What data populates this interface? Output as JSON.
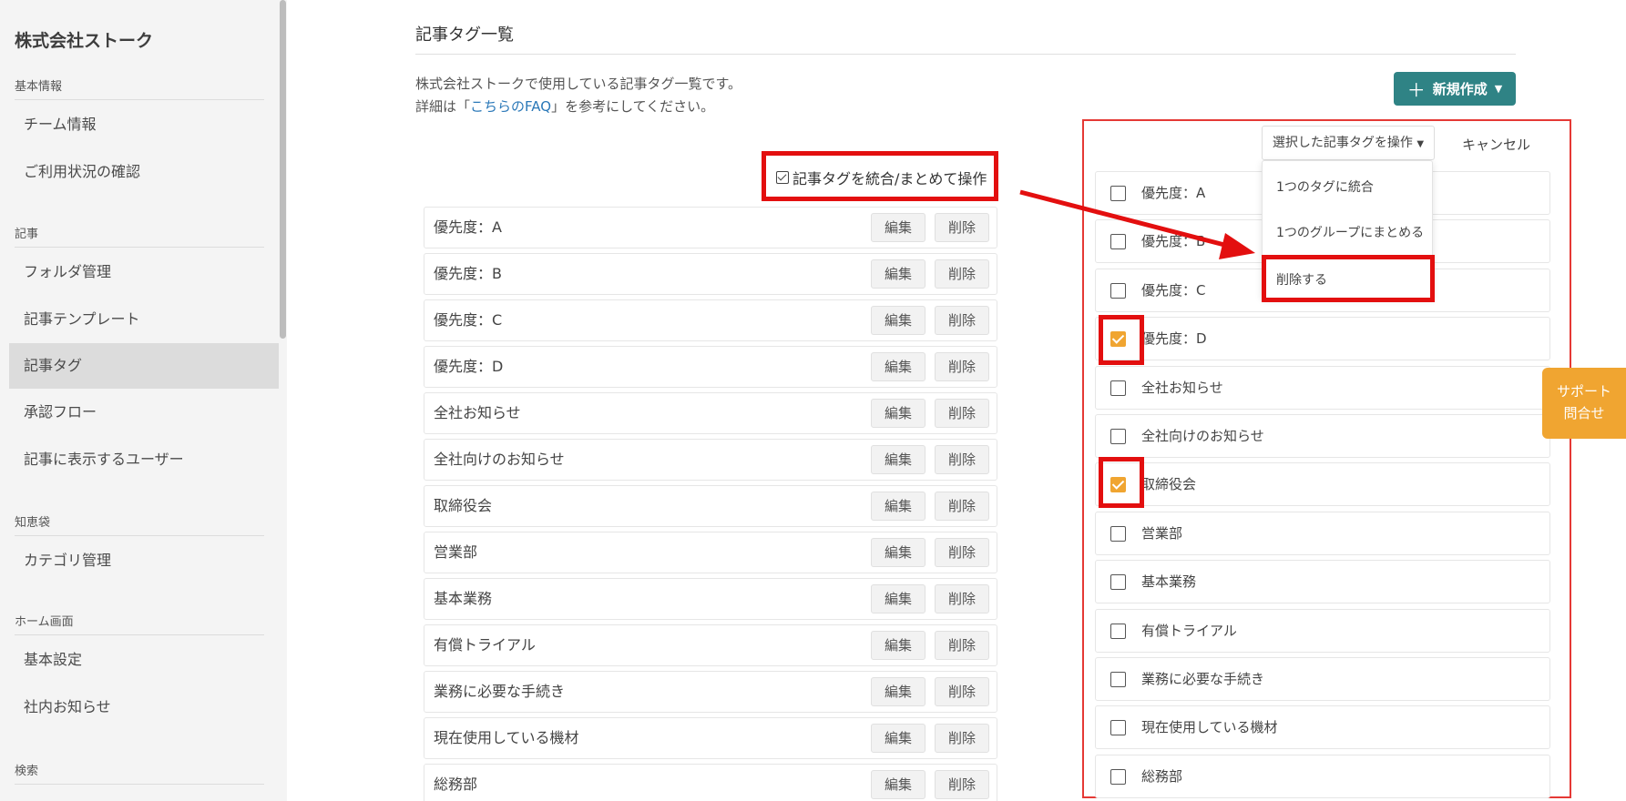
{
  "sidebar": {
    "brand": "株式会社ストーク",
    "sections": [
      {
        "heading": "基本情報",
        "items": [
          "チーム情報",
          "ご利用状況の確認"
        ]
      },
      {
        "heading": "記事",
        "items": [
          "フォルダ管理",
          "記事テンプレート",
          "記事タグ",
          "承認フロー",
          "記事に表示するユーザー"
        ]
      },
      {
        "heading": "知恵袋",
        "items": [
          "カテゴリ管理"
        ]
      },
      {
        "heading": "ホーム画面",
        "items": [
          "基本設定",
          "社内お知らせ"
        ]
      },
      {
        "heading": "検索",
        "items": []
      }
    ],
    "active_item": "記事タグ"
  },
  "main": {
    "title": "記事タグ一覧",
    "desc_line1": "株式会社ストークで使用している記事タグ一覧です。",
    "desc_line2_pre": "詳細は「",
    "desc_line2_link": "こちらのFAQ",
    "desc_line2_post": "」を参考にしてください。",
    "new_button": "新規作成",
    "merge_link": "記事タグを統合/まとめて操作",
    "edit_label": "編集",
    "delete_label": "削除",
    "tags": [
      "優先度：A",
      "優先度：B",
      "優先度：C",
      "優先度：D",
      "全社お知らせ",
      "全社向けのお知らせ",
      "取締役会",
      "営業部",
      "基本業務",
      "有償トライアル",
      "業務に必要な手続き",
      "現在使用している機材",
      "総務部"
    ]
  },
  "panel": {
    "operate_dropdown": "選択した記事タグを操作",
    "cancel": "キャンセル",
    "menu_items": [
      "1つのタグに統合",
      "1つのグループにまとめる",
      "削除する"
    ],
    "rows": [
      {
        "label": "優先度：A",
        "checked": false
      },
      {
        "label": "優先度：B",
        "checked": false
      },
      {
        "label": "優先度：C",
        "checked": false
      },
      {
        "label": "優先度：D",
        "checked": true
      },
      {
        "label": "全社お知らせ",
        "checked": false
      },
      {
        "label": "全社向けのお知らせ",
        "checked": false
      },
      {
        "label": "取締役会",
        "checked": true
      },
      {
        "label": "営業部",
        "checked": false
      },
      {
        "label": "基本業務",
        "checked": false
      },
      {
        "label": "有償トライアル",
        "checked": false
      },
      {
        "label": "業務に必要な手続き",
        "checked": false
      },
      {
        "label": "現在使用している機材",
        "checked": false
      },
      {
        "label": "総務部",
        "checked": false
      }
    ]
  },
  "support": {
    "line1": "サポート",
    "line2": "問合せ"
  },
  "colors": {
    "accent": "#2f8385",
    "highlight": "#e30f0f",
    "checked": "#f0a531",
    "link": "#2a78b8"
  }
}
